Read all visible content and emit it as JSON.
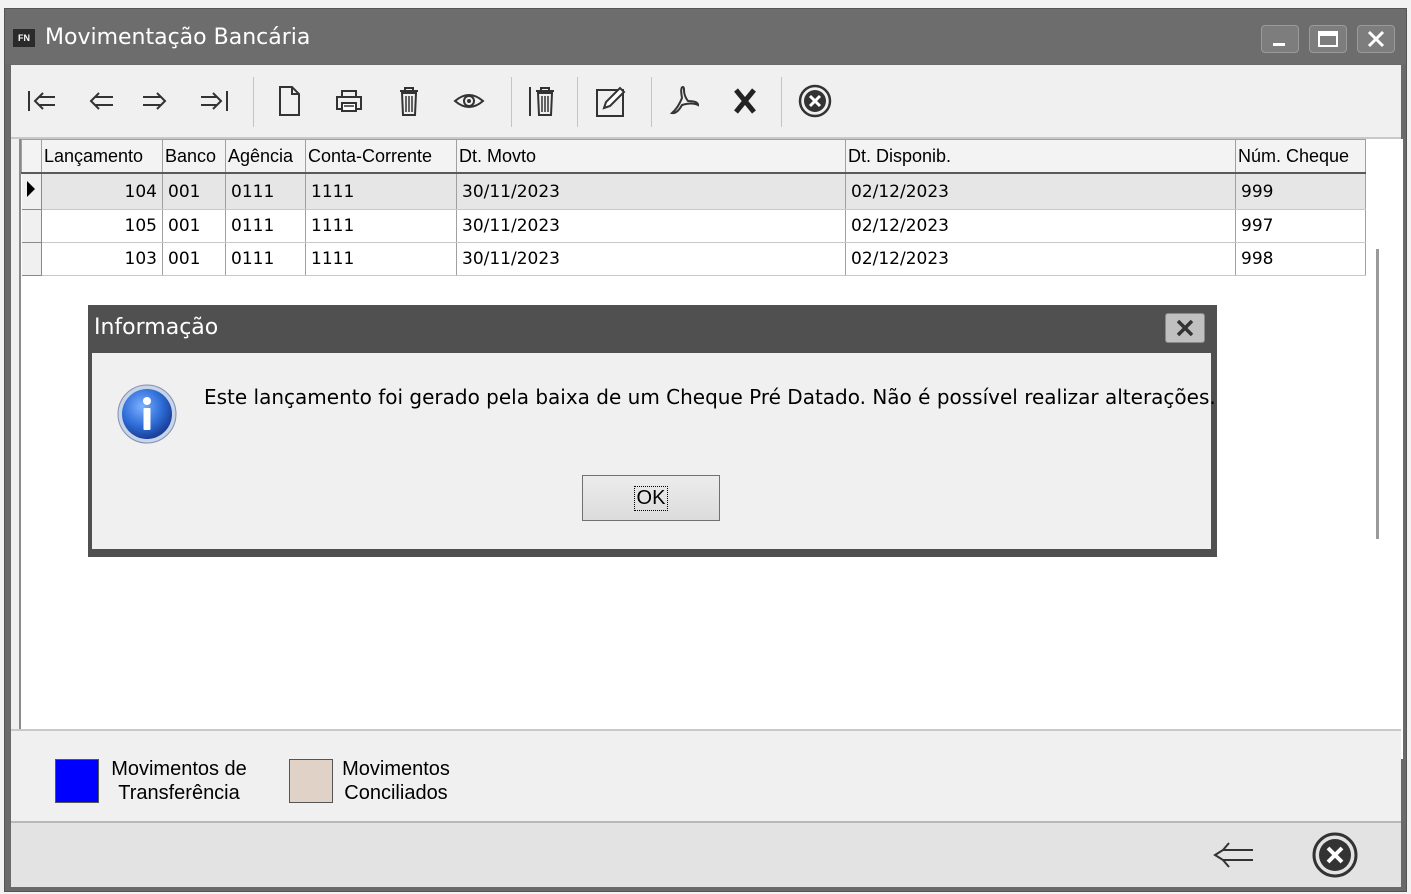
{
  "window": {
    "app_icon_text": "FN",
    "title": "Movimentação Bancária",
    "buttons": [
      "minimize-icon",
      "maximize-icon",
      "close-icon"
    ]
  },
  "toolbar": {
    "icons": [
      "first-record-icon",
      "previous-record-icon",
      "next-record-icon",
      "last-record-icon",
      "new-document-icon",
      "print-icon",
      "delete-icon",
      "view-icon",
      "delete-all-icon",
      "edit-icon",
      "pdf-icon",
      "excel-icon",
      "cancel-icon"
    ]
  },
  "grid": {
    "columns": [
      "Lançamento",
      "Banco",
      "Agência",
      "Conta-Corrente",
      "Dt. Movto",
      "Dt. Disponib.",
      "Núm. Cheque"
    ],
    "rows": [
      {
        "lancamento": "104",
        "banco": "001",
        "agencia": "0111",
        "conta": "1111",
        "dt_movto": "30/11/2023",
        "dt_disponib": "02/12/2023",
        "num_cheque": "999",
        "selected": true
      },
      {
        "lancamento": "105",
        "banco": "001",
        "agencia": "0111",
        "conta": "1111",
        "dt_movto": "30/11/2023",
        "dt_disponib": "02/12/2023",
        "num_cheque": "997",
        "selected": false
      },
      {
        "lancamento": "103",
        "banco": "001",
        "agencia": "0111",
        "conta": "1111",
        "dt_movto": "30/11/2023",
        "dt_disponib": "02/12/2023",
        "num_cheque": "998",
        "selected": false
      }
    ]
  },
  "legend": {
    "items": [
      {
        "line1": "Movimentos de",
        "line2": "Transferência",
        "color": "#0000ff"
      },
      {
        "line1": "Movimentos",
        "line2": "Conciliados",
        "color": "#e0d2c6"
      }
    ]
  },
  "dialog": {
    "title": "Informação",
    "message": "Este lançamento foi gerado pela baixa de um Cheque Pré Datado. Não é possível realizar alterações.",
    "ok_label": "OK",
    "icon": "info-icon"
  },
  "bottom_bar": {
    "icons": [
      "back-arrow-icon",
      "cancel-icon"
    ]
  }
}
